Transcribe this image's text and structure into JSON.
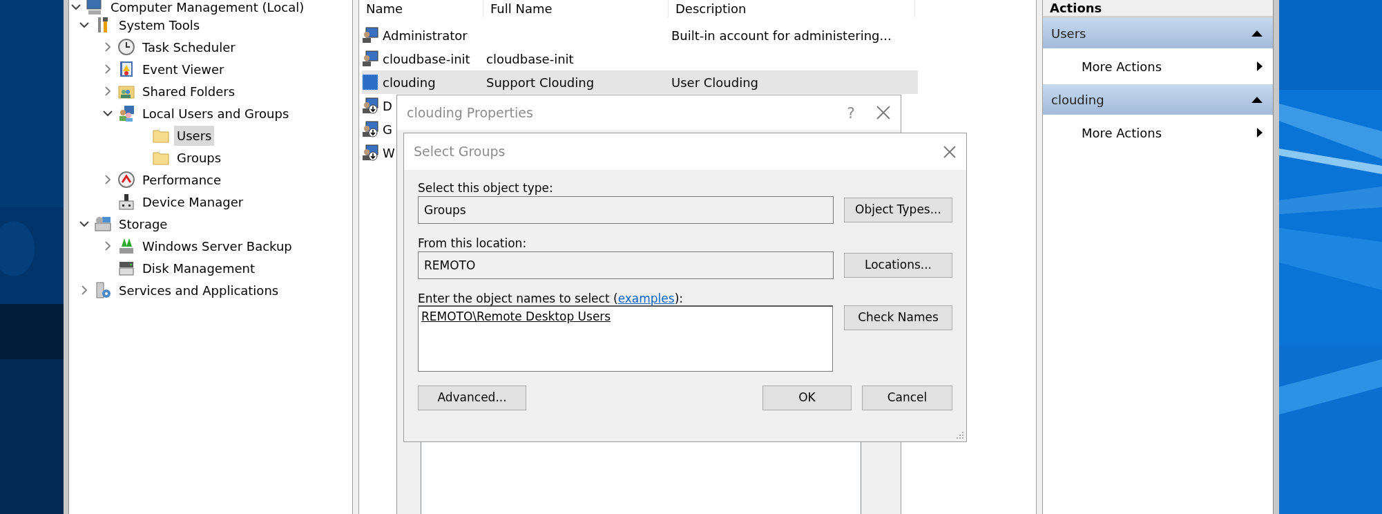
{
  "tree": [
    {
      "label": "Computer Management (Local)",
      "expanded": true,
      "children": [
        {
          "label": "System Tools",
          "expanded": true,
          "children": [
            {
              "label": "Task Scheduler",
              "expanded": false
            },
            {
              "label": "Event Viewer",
              "expanded": false
            },
            {
              "label": "Shared Folders",
              "expanded": false
            },
            {
              "label": "Local Users and Groups",
              "expanded": true,
              "children": [
                {
                  "label": "Users",
                  "selected": true
                },
                {
                  "label": "Groups",
                  "selected": false
                }
              ]
            },
            {
              "label": "Performance",
              "expanded": false
            },
            {
              "label": "Device Manager"
            }
          ]
        },
        {
          "label": "Storage",
          "expanded": true,
          "children": [
            {
              "label": "Windows Server Backup",
              "expanded": false
            },
            {
              "label": "Disk Management"
            }
          ]
        },
        {
          "label": "Services and Applications",
          "expanded": false
        }
      ]
    }
  ],
  "list": {
    "columns": [
      "Name",
      "Full Name",
      "Description"
    ],
    "rows": [
      {
        "cells": [
          "Administrator",
          "",
          "Built-in account for administering..."
        ],
        "selected": false,
        "disabled": false
      },
      {
        "cells": [
          "cloudbase-init",
          "cloudbase-init",
          ""
        ],
        "selected": false,
        "disabled": false
      },
      {
        "cells": [
          "clouding",
          "Support Clouding",
          "User Clouding"
        ],
        "selected": true,
        "disabled": false
      },
      {
        "cells": [
          "D",
          "",
          ""
        ],
        "selected": false,
        "disabled": true
      },
      {
        "cells": [
          "G",
          "",
          ""
        ],
        "selected": false,
        "disabled": true
      },
      {
        "cells": [
          "W",
          "",
          ""
        ],
        "selected": false,
        "disabled": true
      }
    ]
  },
  "actions": {
    "title": "Actions",
    "sections": [
      {
        "title": "Users",
        "expanded": true,
        "items": [
          "More Actions"
        ]
      },
      {
        "title": "clouding",
        "expanded": true,
        "items": [
          "More Actions"
        ]
      }
    ]
  },
  "properties_dialog": {
    "title": "clouding Properties",
    "help": "?"
  },
  "select_dialog": {
    "title": "Select Groups",
    "type_label": "Select this object type:",
    "type_value": "Groups",
    "type_button": "Object Types...",
    "location_label": "From this location:",
    "location_value": "REMOTO",
    "location_button": "Locations...",
    "names_label": {
      "before": "Enter the object names to select (",
      "link": "examples",
      "after": "):"
    },
    "names_value": "REMOTO\\Remote Desktop Users",
    "check_button": "Check Names",
    "advanced_button": "Advanced...",
    "ok_button": "OK",
    "cancel_button": "Cancel"
  }
}
